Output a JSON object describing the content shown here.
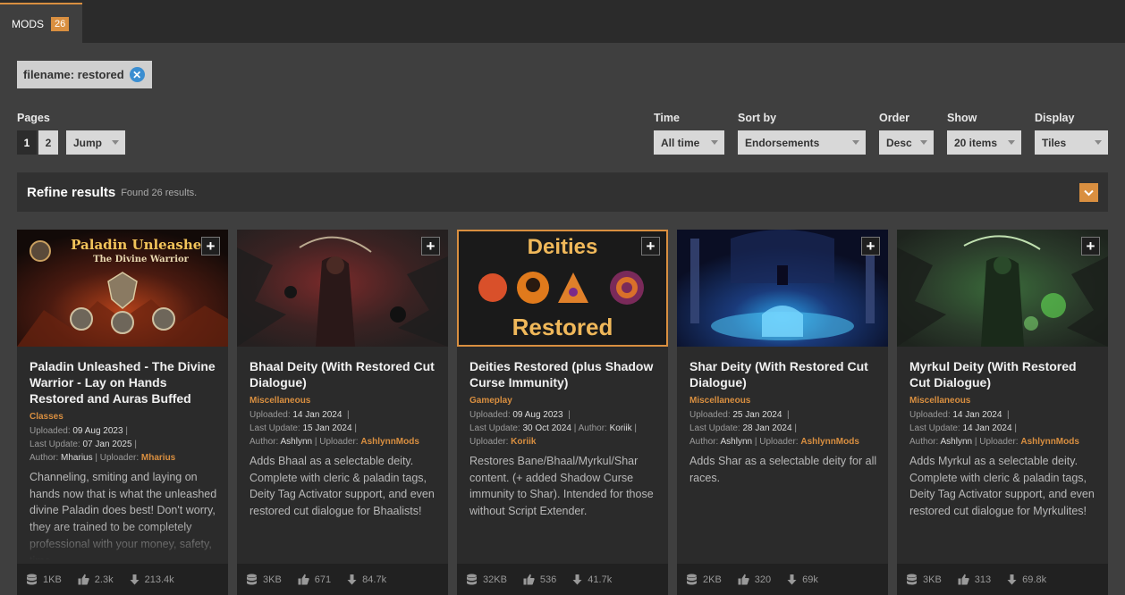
{
  "tabs": {
    "mods_label": "MODS",
    "mods_count": "26"
  },
  "filter": {
    "text": "filename: restored",
    "remove_icon": "close-icon"
  },
  "pages": {
    "label": "Pages",
    "page1": "1",
    "page2": "2",
    "jump": "Jump"
  },
  "controls": {
    "time": {
      "label": "Time",
      "value": "All time"
    },
    "sort": {
      "label": "Sort by",
      "value": "Endorsements"
    },
    "order": {
      "label": "Order",
      "value": "Desc"
    },
    "show": {
      "label": "Show",
      "value": "20 items"
    },
    "display": {
      "label": "Display",
      "value": "Tiles"
    }
  },
  "refine": {
    "title": "Refine results",
    "found": "Found 26 results.",
    "toggle_icon": "chevron-down-icon"
  },
  "colors": {
    "accent": "#d98f40",
    "background": "#3f3f3f",
    "card": "#2b2b2b"
  },
  "cards": [
    {
      "image_title": "Paladin Unleashed",
      "image_subtitle": "The Divine Warrior",
      "title": "Paladin Unleashed - The Divine Warrior - Lay on Hands Restored and Auras Buffed",
      "category": "Classes",
      "uploaded_label": "Uploaded:",
      "uploaded": "09 Aug 2023",
      "updated_label": "Last Update:",
      "updated": "07 Jan 2025",
      "author_label": "Author:",
      "author": "Mharius",
      "uploader_label": "Uploader:",
      "uploader": "Mharius",
      "description": "Channeling, smiting and laying on hands now that is what the unleashed divine Paladin does best! Don't worry, they are trained to be completely professional with your money, safety, time...",
      "size": "1KB",
      "endorsements": "2.3k",
      "downloads": "213.4k"
    },
    {
      "title": "Bhaal Deity (With Restored Cut Dialogue)",
      "category": "Miscellaneous",
      "uploaded_label": "Uploaded:",
      "uploaded": "14 Jan 2024",
      "updated_label": "Last Update:",
      "updated": "15 Jan 2024",
      "author_label": "Author:",
      "author": "Ashlynn",
      "uploader_label": "Uploader:",
      "uploader": "AshlynnMods",
      "description": "Adds Bhaal as a selectable deity. Complete with cleric & paladin tags, Deity Tag Activator support, and even restored cut dialogue for Bhaalists!",
      "size": "3KB",
      "endorsements": "671",
      "downloads": "84.7k"
    },
    {
      "image_title": "Deities",
      "image_subtitle": "Restored",
      "title": "Deities Restored (plus Shadow Curse Immunity)",
      "category": "Gameplay",
      "uploaded_label": "Uploaded:",
      "uploaded": "09 Aug 2023",
      "updated_label": "Last Update:",
      "updated": "30 Oct 2024",
      "author_label": "Author:",
      "author": "Koriik",
      "uploader_label": "Uploader:",
      "uploader": "Koriik",
      "description": "Restores Bane/Bhaal/Myrkul/Shar content. (+ added Shadow Curse immunity to Shar). Intended for those without Script Extender.",
      "size": "32KB",
      "endorsements": "536",
      "downloads": "41.7k"
    },
    {
      "title": "Shar Deity (With Restored Cut Dialogue)",
      "category": "Miscellaneous",
      "uploaded_label": "Uploaded:",
      "uploaded": "25 Jan 2024",
      "updated_label": "Last Update:",
      "updated": "28 Jan 2024",
      "author_label": "Author:",
      "author": "Ashlynn",
      "uploader_label": "Uploader:",
      "uploader": "AshlynnMods",
      "description": "Adds Shar as a selectable deity for all races.",
      "size": "2KB",
      "endorsements": "320",
      "downloads": "69k"
    },
    {
      "title": "Myrkul Deity (With Restored Cut Dialogue)",
      "category": "Miscellaneous",
      "uploaded_label": "Uploaded:",
      "uploaded": "14 Jan 2024",
      "updated_label": "Last Update:",
      "updated": "14 Jan 2024",
      "author_label": "Author:",
      "author": "Ashlynn",
      "uploader_label": "Uploader:",
      "uploader": "AshlynnMods",
      "description": "Adds Myrkul as a selectable deity. Complete with cleric & paladin tags, Deity Tag Activator support, and even restored cut dialogue for Myrkulites!",
      "size": "3KB",
      "endorsements": "313",
      "downloads": "69.8k"
    }
  ]
}
